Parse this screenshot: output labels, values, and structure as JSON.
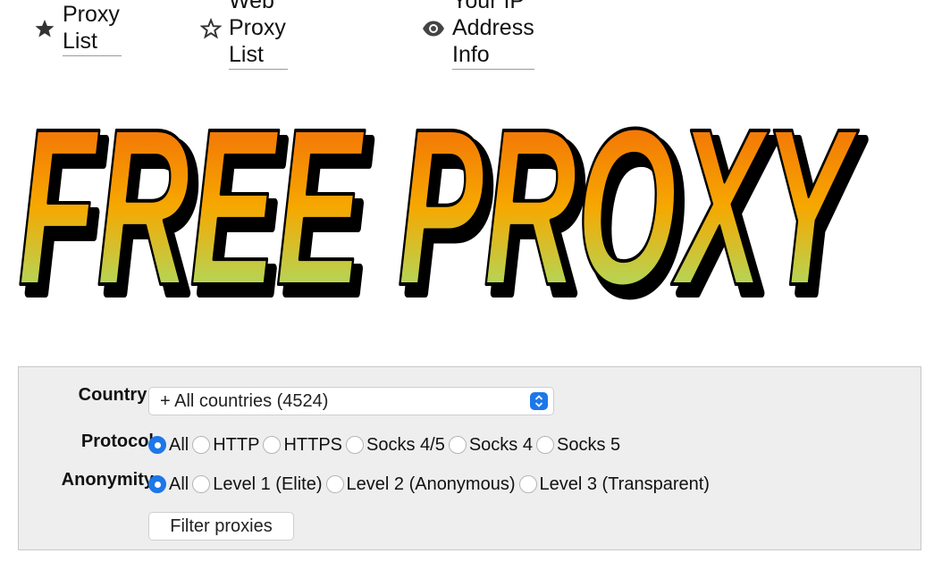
{
  "nav": {
    "items": [
      {
        "label": "Proxy List",
        "icon": "star-filled-icon"
      },
      {
        "label": "Web Proxy List",
        "icon": "star-outline-icon"
      },
      {
        "label": "Your IP Address Info",
        "icon": "eye-icon"
      }
    ]
  },
  "logo": {
    "text": "FREE PROXY"
  },
  "filter": {
    "country": {
      "label": "Country:",
      "selected": "+ All countries (4524)"
    },
    "protocol": {
      "label": "Protocol",
      "options": [
        "All",
        "HTTP",
        "HTTPS",
        "Socks 4/5",
        "Socks 4",
        "Socks 5"
      ],
      "selected": "All"
    },
    "anonymity": {
      "label": "Anonymity",
      "options": [
        "All",
        "Level 1 (Elite)",
        "Level 2 (Anonymous)",
        "Level 3 (Transparent)"
      ],
      "selected": "All"
    },
    "submit_label": "Filter proxies"
  },
  "colors": {
    "accent": "#1d77e8",
    "logo_gradient": [
      "#f25a0a",
      "#f6a800",
      "#8ef08a"
    ],
    "panel_bg": "#eeeeee"
  }
}
